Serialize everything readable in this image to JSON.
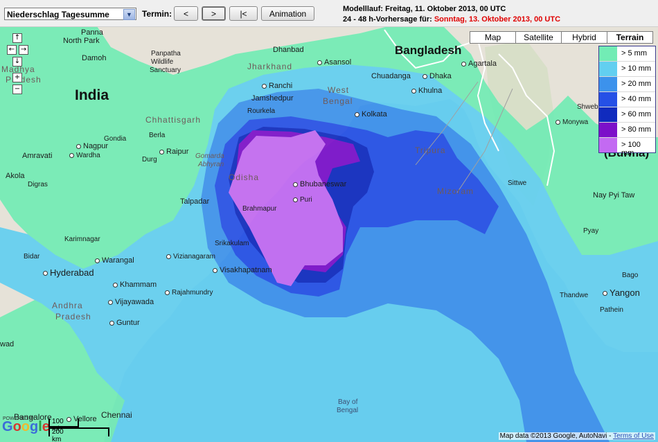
{
  "toolbar": {
    "product_select": "Niederschlag Tagesumme",
    "termin_label": "Termin:",
    "btn_prev": "<",
    "btn_next": ">",
    "btn_first": "|<",
    "btn_animation": "Animation",
    "model_run": "Modelllauf: Freitag, 11. Oktober 2013, 00 UTC",
    "forecast_prefix": "24 - 48 h-Vorhersage für: ",
    "forecast_date": "Sonntag, 13. Oktober 2013, 00 UTC"
  },
  "colors": {
    "forecast_date": "#e00000",
    "land": "#e6e2d8",
    "sea": "#aab8d9"
  },
  "map_types": [
    "Map",
    "Satellite",
    "Hybrid",
    "Terrain"
  ],
  "active_map_type": "Terrain",
  "legend": [
    {
      "label": "> 5 mm",
      "color": "#72ecb5"
    },
    {
      "label": "> 10 mm",
      "color": "#62cff0"
    },
    {
      "label": "> 20 mm",
      "color": "#3c92ec"
    },
    {
      "label": "> 40 mm",
      "color": "#2550e6"
    },
    {
      "label": "> 60 mm",
      "color": "#102bbe"
    },
    {
      "label": "> 80 mm",
      "color": "#7c10c9"
    },
    {
      "label": "> 100 mm",
      "color": "#c36af2"
    }
  ],
  "nav_icons": [
    "arrow-up-icon",
    "arrow-left-icon",
    "arrow-right-icon",
    "arrow-down-icon",
    "zoom-in-icon",
    "zoom-out-icon"
  ],
  "labels": {
    "countries": {
      "india": "India",
      "bangladesh": "Bangladesh",
      "burma": "(Burma)"
    },
    "regions": {
      "madhya": "Madhya",
      "pradesh1": "Pradesh",
      "chhattisgarh": "Chhattisgarh",
      "jharkhand": "Jharkhand",
      "west_bengal_1": "West",
      "west_bengal_2": "Bengal",
      "odisha": "Odisha",
      "tripura": "Tripura",
      "mizoram": "Mizoram",
      "andhra": "Andhra",
      "pradesh2": "Pradesh",
      "gomarda": "Gomarda",
      "abhyran": "Abhyran"
    },
    "water": {
      "bay1": "Bay of",
      "bay2": "Bengal"
    },
    "cities": {
      "panna": "Panna",
      "north_park": "North Park",
      "damoh": "Damoh",
      "panpatha": "Panpatha",
      "wildlife": "Wildlife",
      "sanctuary": "Sanctuary",
      "dhanbad": "Dhanbad",
      "asansol": "Asansol",
      "ranchi": "Ranchi",
      "jamshedpur": "Jamshedpur",
      "rourkela": "Rourkela",
      "kolkata": "Kolkata",
      "chuadanga": "Chuadanga",
      "khulna": "Khulna",
      "dhaka": "Dhaka",
      "agartala": "Agartala",
      "nagpur": "Nagpur",
      "gondia": "Gondia",
      "berla": "Berla",
      "raipur": "Raipur",
      "durg": "Durg",
      "amravati": "Amravati",
      "wardha": "Wardha",
      "akola": "Akola",
      "digras": "Digras",
      "talpadar": "Talpadar",
      "brahmapur": "Brahmapur",
      "bhubaneswar": "Bhubaneswar",
      "puri": "Puri",
      "srikakulam": "Srikakulam",
      "vizianagaram": "Vizianagaram",
      "visakhapatnam": "Visakhapatnam",
      "karimnagar": "Karimnagar",
      "warangal": "Warangal",
      "bidar": "Bidar",
      "hyderabad": "Hyderabad",
      "khammam": "Khammam",
      "rajahmundry": "Rajahmundry",
      "vijayawada": "Vijayawada",
      "guntur": "Guntur",
      "bangalore": "Bangalore",
      "vellore": "Vellore",
      "chennai": "Chennai",
      "awad": "wad",
      "shwebo": "Shwebo",
      "monywa": "Monywa",
      "sittwe": "Sittwe",
      "nay_pyi_taw1": "Nay Pyi Taw",
      "pyay": "Pyay",
      "bago": "Bago",
      "yangon": "Yangon",
      "pathein": "Pathein",
      "thandwe": "Thandwe"
    }
  },
  "footer": {
    "powered": "POWERED BY",
    "google": "Google",
    "scale_km_small": "100 mi",
    "scale_km": "200 km",
    "attribution": "Map data ©2013 Google, AutoNavi -",
    "terms": "Terms of Use"
  }
}
